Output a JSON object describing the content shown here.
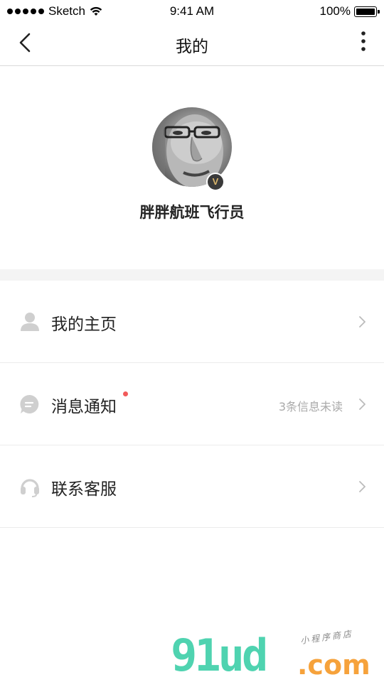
{
  "status_bar": {
    "carrier": "Sketch",
    "time": "9:41 AM",
    "battery": "100%"
  },
  "nav": {
    "title": "我的"
  },
  "profile": {
    "username": "胖胖航班飞行员",
    "badge": "V"
  },
  "menu": {
    "items": [
      {
        "label": "我的主页",
        "icon": "person-icon",
        "hint": ""
      },
      {
        "label": "消息通知",
        "icon": "message-icon",
        "hint": "3条信息未读"
      },
      {
        "label": "联系客服",
        "icon": "headset-icon",
        "hint": ""
      }
    ]
  },
  "watermark": {
    "main": "91ud",
    "com": ".com",
    "sub": "小程序商店"
  },
  "colors": {
    "accent_dot": "#f25a5a",
    "icon_gray": "#cfcfcf",
    "watermark_green": "#4fd3b0",
    "watermark_orange": "#f6a23b"
  }
}
